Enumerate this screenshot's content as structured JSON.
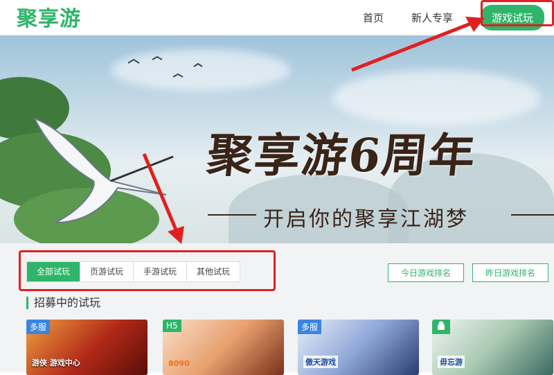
{
  "header": {
    "logo": "聚享游",
    "nav": [
      "首页",
      "新人专享"
    ],
    "cta": "游戏试玩"
  },
  "banner": {
    "title": "聚享游6周年",
    "subtitle": "开启你的聚享江湖梦"
  },
  "tabs": [
    "全部试玩",
    "页游试玩",
    "手游试玩",
    "其他试玩"
  ],
  "ranks": [
    "今日游戏排名",
    "昨日游戏排名"
  ],
  "section": {
    "title": "招募中的试玩"
  },
  "cards": [
    {
      "badge": "多服",
      "caption": "游侠 游戏中心"
    },
    {
      "badge": "H5",
      "caption": "8090"
    },
    {
      "badge": "多服",
      "caption": "傲天游戏"
    },
    {
      "badge": "",
      "caption": "毋忘游"
    }
  ],
  "colors": {
    "accent": "#2fb56a",
    "highlight": "#e02020"
  }
}
